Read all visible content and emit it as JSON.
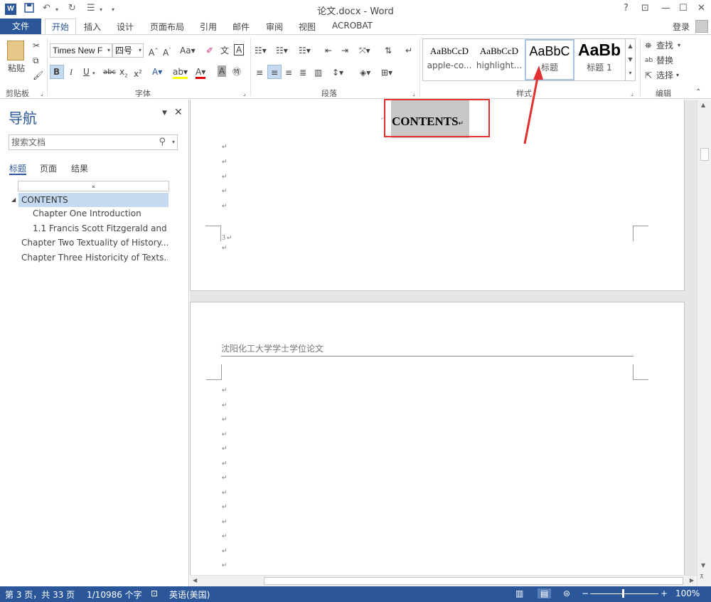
{
  "titlebar": {
    "title": "论文.docx - Word",
    "logo": "W",
    "save_icon": "save-icon",
    "undo_icon": "undo-icon",
    "redo_icon": "redo-icon",
    "help": "?",
    "minimize": "—",
    "maximize": "☐",
    "close": "✕"
  },
  "tabs": {
    "file": "文件",
    "active": "开始",
    "items": [
      "插入",
      "设计",
      "页面布局",
      "引用",
      "邮件",
      "审阅",
      "视图",
      "ACROBAT"
    ],
    "login": "登录"
  },
  "ribbon": {
    "clipboard": {
      "paste": "粘贴",
      "label": "剪贴板"
    },
    "font": {
      "name": "Times New F",
      "size": "四号",
      "label": "字体"
    },
    "paragraph": {
      "label": "段落"
    },
    "styles": {
      "label": "样式",
      "items": [
        {
          "sample": "AaBbCcD",
          "name": "apple-co..."
        },
        {
          "sample": "AaBbCcD",
          "name": "highlight..."
        },
        {
          "sample": "AaBbC",
          "name": "标题"
        },
        {
          "sample": "AaBb",
          "name": "标题 1"
        }
      ]
    },
    "editing": {
      "find": "查找",
      "replace": "替换",
      "select": "选择",
      "label": "编辑"
    }
  },
  "nav": {
    "title": "导航",
    "search_placeholder": "搜索文档",
    "tabs": [
      "标题",
      "页面",
      "结果"
    ],
    "items": [
      "CONTENTS",
      "Chapter One Introduction",
      "1.1 Francis Scott Fitzgerald and...",
      "Chapter Two Textuality of History...",
      "Chapter Three Historicity of Texts..."
    ]
  },
  "document": {
    "heading": "CONTENTS",
    "page_number": "3",
    "header_text": "沈阳化工大学学士学位论文",
    "para_mark": "↵"
  },
  "status": {
    "page": "第 3 页，共 33 页",
    "words": "1/10986 个字",
    "lang": "英语(美国)",
    "zoom": "100%"
  },
  "colors": {
    "accent": "#2b579a",
    "highlight": "#c5d9f1",
    "annotation": "#e03030"
  }
}
